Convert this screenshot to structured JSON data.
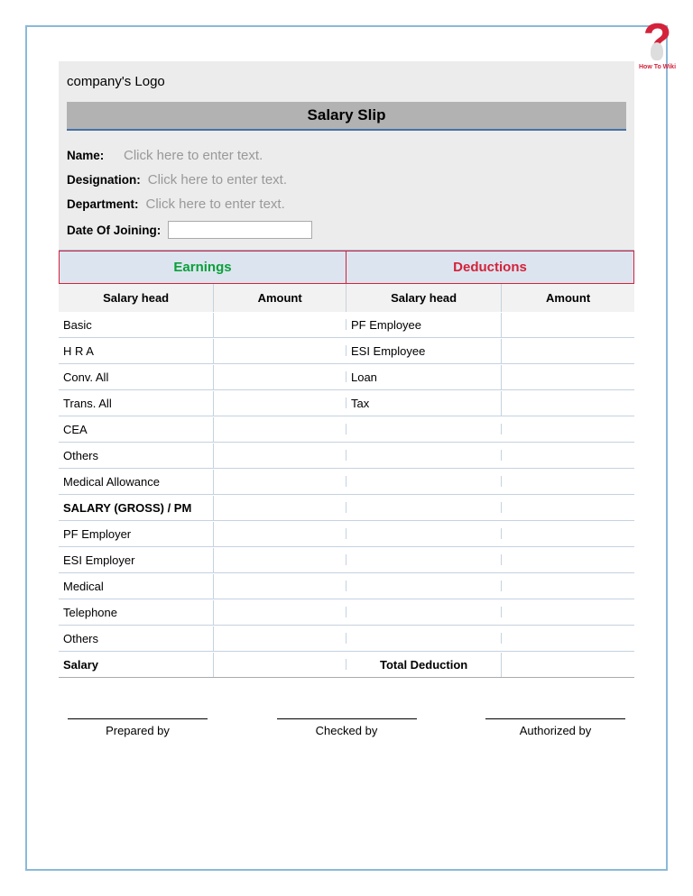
{
  "wikiLabel": "How To Wiki",
  "logoText": "company's Logo",
  "title": "Salary Slip",
  "fields": {
    "name": {
      "label": "Name:",
      "placeholder": "Click here to enter text."
    },
    "designation": {
      "label": "Designation:",
      "placeholder": "Click here to enter text."
    },
    "department": {
      "label": "Department:",
      "placeholder": "Click here to enter text."
    },
    "doj": {
      "label": "Date Of Joining:"
    }
  },
  "sectionHeaders": {
    "earnings": "Earnings",
    "deductions": "Deductions"
  },
  "columnHeaders": {
    "c1": "Salary head",
    "c2": "Amount",
    "c3": "Salary head",
    "c4": "Amount"
  },
  "rows": [
    {
      "c1": "Basic",
      "c2": "",
      "c3": "PF Employee",
      "c4": "",
      "bold": false
    },
    {
      "c1": "H R A",
      "c2": "",
      "c3": "ESI Employee",
      "c4": "",
      "bold": false
    },
    {
      "c1": "Conv. All",
      "c2": "",
      "c3": "Loan",
      "c4": "",
      "bold": false
    },
    {
      "c1": "Trans. All",
      "c2": "",
      "c3": "Tax",
      "c4": "",
      "bold": false
    },
    {
      "c1": "CEA",
      "c2": "",
      "c3": "",
      "c4": "",
      "bold": false
    },
    {
      "c1": "Others",
      "c2": "",
      "c3": "",
      "c4": "",
      "bold": false
    },
    {
      "c1": "Medical Allowance",
      "c2": "",
      "c3": "",
      "c4": "",
      "bold": false
    },
    {
      "c1": "SALARY (GROSS) / PM",
      "c2": "",
      "c3": "",
      "c4": "",
      "bold": true
    },
    {
      "c1": "PF Employer",
      "c2": "",
      "c3": "",
      "c4": "",
      "bold": false
    },
    {
      "c1": "ESI Employer",
      "c2": "",
      "c3": "",
      "c4": "",
      "bold": false
    },
    {
      "c1": "Medical",
      "c2": "",
      "c3": "",
      "c4": "",
      "bold": false
    },
    {
      "c1": "Telephone",
      "c2": "",
      "c3": "",
      "c4": "",
      "bold": false
    },
    {
      "c1": "Others",
      "c2": "",
      "c3": "",
      "c4": "",
      "bold": false
    }
  ],
  "lastRow": {
    "c1": "Salary",
    "c3": "Total Deduction"
  },
  "signatures": {
    "prepared": "Prepared by",
    "checked": "Checked by",
    "authorized": "Authorized by"
  }
}
